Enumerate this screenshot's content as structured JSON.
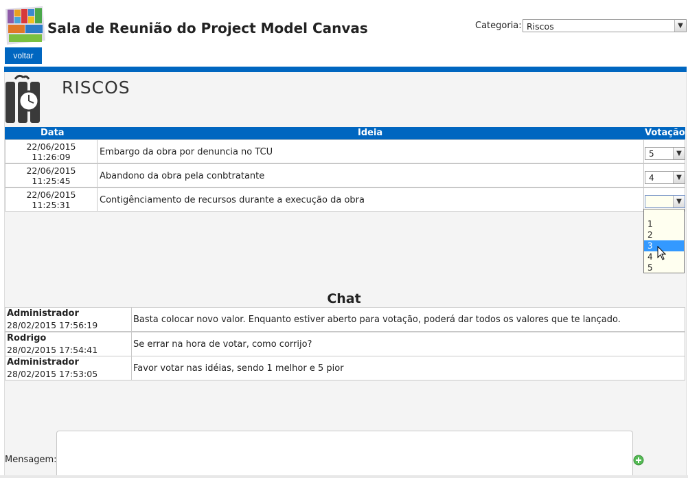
{
  "header": {
    "title": "Sala de Reunião do Project Model Canvas",
    "category_label": "Categoria:",
    "category_value": "Riscos",
    "back_button": "voltar"
  },
  "section": {
    "title": "RISCOS"
  },
  "ideas": {
    "columns": {
      "date": "Data",
      "idea": "Ideia",
      "vote": "Votação"
    },
    "rows": [
      {
        "date": "22/06/2015",
        "time": "11:26:09",
        "text": "Embargo da obra por denuncia no TCU",
        "vote": "5"
      },
      {
        "date": "22/06/2015",
        "time": "11:25:45",
        "text": "Abandono da obra pela conbtratante",
        "vote": "4"
      },
      {
        "date": "22/06/2015",
        "time": "11:25:31",
        "text": "Contigênciamento de recursos durante a execução da obra",
        "vote": ""
      }
    ],
    "vote_options": [
      "",
      "1",
      "2",
      "3",
      "4",
      "5"
    ],
    "highlighted_option": "3"
  },
  "chat": {
    "title": "Chat",
    "messages": [
      {
        "user": "Administrador",
        "time": "28/02/2015 17:56:19",
        "text": "Basta colocar novo valor. Enquanto estiver aberto para votação, poderá dar todos os valores que te lançado."
      },
      {
        "user": "Rodrigo",
        "time": "28/02/2015 17:54:41",
        "text": "Se errar na hora de votar, como corrijo?"
      },
      {
        "user": "Administrador",
        "time": "28/02/2015 17:53:05",
        "text": "Favor votar nas idéias, sendo 1 melhor e 5 pior"
      }
    ],
    "message_label": "Mensagem:"
  },
  "colors": {
    "accent": "#0066c0",
    "panel_bg": "#f4f4f4",
    "selected_option": "#3399ff",
    "add_button": "#55bb55"
  },
  "icons": {
    "logo": "project-model-canvas-logo",
    "section": "dynamite-clock-icon",
    "dropdown": "chevron-down-icon",
    "add": "plus-circle-icon",
    "cursor": "mouse-pointer-icon"
  }
}
